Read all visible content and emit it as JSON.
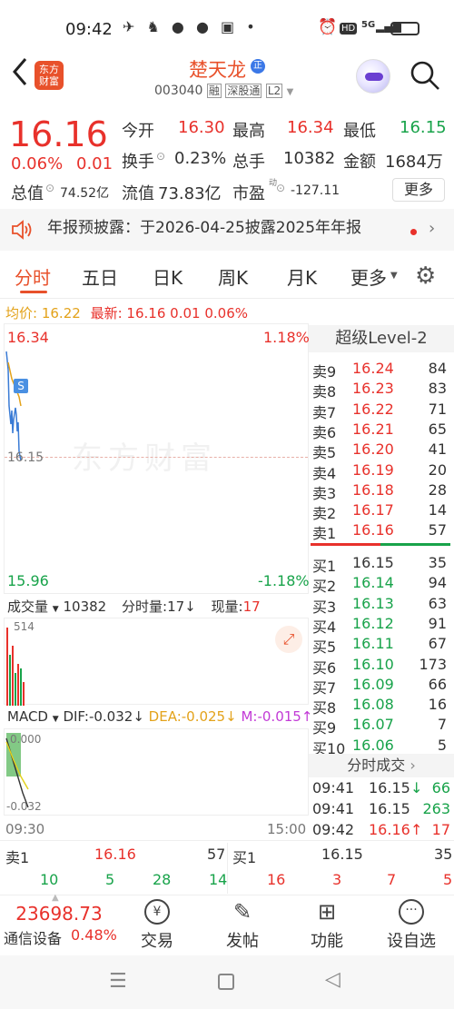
{
  "status_bar": {
    "time": "09:42",
    "network": "5G",
    "hd": "HD"
  },
  "header": {
    "back": "<",
    "logo": "东方\n财富",
    "stock_name": "楚天龙",
    "name_badge": "正",
    "code": "003040",
    "tag_rong": "融",
    "tag_sgt": "深股通",
    "tag_level": "L2"
  },
  "quote": {
    "price": "16.16",
    "change_pct": "0.06%",
    "change": "0.01",
    "open_label": "今开",
    "open": "16.30",
    "high_label": "最高",
    "high": "16.34",
    "low_label": "最低",
    "low": "16.15",
    "turnover_label": "换手",
    "turnover": "0.23%",
    "volume_label": "总手",
    "volume": "10382",
    "amount_label": "金额",
    "amount": "1684万",
    "total_cap_label": "总值",
    "total_cap": "74.52亿",
    "float_cap_label": "流值",
    "float_cap": "73.83亿",
    "pe_label": "市盈",
    "pe_sup": "动",
    "pe": "-127.11",
    "more": "更多"
  },
  "notice": {
    "text": "年报预披露：于2026-04-25披露2025年年报"
  },
  "tabs": [
    "分时",
    "五日",
    "日K",
    "周K",
    "月K",
    "更多"
  ],
  "avg_bar": {
    "avg_label": "均价:",
    "avg": "16.22",
    "latest_label": "最新:",
    "latest": "16.16",
    "chg": "0.01",
    "pct": "0.06%"
  },
  "chart": {
    "top_price": "16.34",
    "top_pct": "1.18%",
    "mid_price": "16.15",
    "bottom_price": "15.96",
    "bottom_pct": "-1.18%",
    "marker": "S",
    "watermark": "东方财富",
    "start_time": "09:30",
    "end_time": "15:00"
  },
  "volume_panel": {
    "label": "成交量",
    "value": "10382",
    "fen_label": "分时量:",
    "fen_value": "17",
    "now_label": "现量:",
    "now_value": "17",
    "max": "514"
  },
  "macd_panel": {
    "label": "MACD",
    "dif": "DIF:-0.032",
    "dea": "DEA:-0.025",
    "m": "M:-0.015",
    "top": "0.000",
    "bottom": "-0.032"
  },
  "level2_title": "超级Level-2",
  "sells": [
    {
      "label": "卖9",
      "price": "16.24",
      "vol": "84"
    },
    {
      "label": "卖8",
      "price": "16.23",
      "vol": "83"
    },
    {
      "label": "卖7",
      "price": "16.22",
      "vol": "71"
    },
    {
      "label": "卖6",
      "price": "16.21",
      "vol": "65"
    },
    {
      "label": "卖5",
      "price": "16.20",
      "vol": "41"
    },
    {
      "label": "卖4",
      "price": "16.19",
      "vol": "20"
    },
    {
      "label": "卖3",
      "price": "16.18",
      "vol": "28"
    },
    {
      "label": "卖2",
      "price": "16.17",
      "vol": "14"
    },
    {
      "label": "卖1",
      "price": "16.16",
      "vol": "57"
    }
  ],
  "buys": [
    {
      "label": "买1",
      "price": "16.15",
      "vol": "35"
    },
    {
      "label": "买2",
      "price": "16.14",
      "vol": "94"
    },
    {
      "label": "买3",
      "price": "16.13",
      "vol": "63"
    },
    {
      "label": "买4",
      "price": "16.12",
      "vol": "91"
    },
    {
      "label": "买5",
      "price": "16.11",
      "vol": "67"
    },
    {
      "label": "买6",
      "price": "16.10",
      "vol": "173"
    },
    {
      "label": "买7",
      "price": "16.09",
      "vol": "66"
    },
    {
      "label": "买8",
      "price": "16.08",
      "vol": "16"
    },
    {
      "label": "买9",
      "price": "16.07",
      "vol": "7"
    },
    {
      "label": "买10",
      "price": "16.06",
      "vol": "5"
    }
  ],
  "ticks_title": "分时成交",
  "ticks": [
    {
      "time": "09:41",
      "price": "16.15",
      "arrow": "↓",
      "vol": "66"
    },
    {
      "time": "09:41",
      "price": "16.15",
      "arrow": "",
      "vol": "263"
    },
    {
      "time": "09:42",
      "price": "16.16",
      "arrow": "↑",
      "vol": "17"
    }
  ],
  "bottom_strip": {
    "sell1_label": "卖1",
    "sell1_price": "16.16",
    "sell1_vol": "57",
    "buy1_label": "买1",
    "buy1_price": "16.15",
    "buy1_vol": "35",
    "nums": [
      "10",
      "5",
      "28",
      "14",
      "16",
      "3",
      "7",
      "5"
    ]
  },
  "index": {
    "value": "23698.73",
    "name": "通信设备",
    "pct": "0.48%"
  },
  "nav": [
    "交易",
    "发帖",
    "功能",
    "设自选"
  ]
}
